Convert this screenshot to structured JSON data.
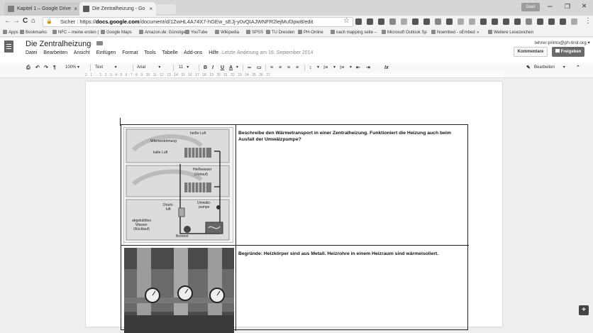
{
  "browser": {
    "tabs": [
      {
        "label": "Kapitel 1 – Google Drive",
        "close": "×"
      },
      {
        "label": "Die Zentralheizung - Go",
        "close": "×"
      }
    ],
    "guest_label": "Gast",
    "window_controls": {
      "minimize": "–",
      "restore": "❐",
      "close": "×"
    },
    "nav": {
      "back": "←",
      "forward": "→",
      "reload": "C",
      "home": "⌂"
    },
    "address": {
      "security": "Sicher",
      "scheme": "https://",
      "host": "docs.google.com",
      "path": "/document/d/1ZwHL4A74X7-hGEw_sEJj-y0vQIAJWNFR2lejMuf3pw8/edit"
    },
    "bookmarks": [
      "Apps",
      "Bookmarks",
      "NFC – meine ersten (",
      "Google Maps",
      "Amazon.de: Günstige",
      "YouTube",
      "Wikipedia",
      "SPSS",
      "TU Dresden",
      "PH-Online",
      "nach mapping seite –",
      "Microsoft Outlook Sp",
      "Noembed - oEmbed",
      "»",
      "Weitere Lesezeichen"
    ]
  },
  "docs": {
    "title": "Die Zentralheizung",
    "menu": [
      "Datei",
      "Bearbeiten",
      "Ansicht",
      "Einfügen",
      "Format",
      "Tools",
      "Tabelle",
      "Add-ons",
      "Hilfe"
    ],
    "last_edit": "Letzte Änderung am 16. September 2014",
    "user_email": "lehrer-primo@ph-tirol.org",
    "comments_button": "Kommentare",
    "share_button": "Freigeben",
    "toolbar": {
      "zoom": "100%",
      "style": "Text",
      "font": "Arial",
      "size": "11",
      "bold": "B",
      "italic": "I",
      "underline": "U",
      "text_color": "A",
      "mode": "Bearbeiten"
    },
    "ruler_marks": "2 · 1 · · · 1 · 2 · 3 · 4 · 5 · 6 · 7 · 8 · 9 · 10 · 11 · 12 · 13 · 14 · 15 · 16 · 17 · 18 · 19 · 20 · 21 · 22 · 23 · 24 · 25 · 26 · 27"
  },
  "document": {
    "diagram_labels": {
      "hot_air": "heiße Luft",
      "heat_flow": "Wärmeströmung",
      "cold_air": "kalte Luft",
      "hot_water": "Heißwasser",
      "flow": "(Vorlauf)",
      "pressure_air": "Druck-\nluft",
      "pump": "Umwälz-\npumpe",
      "cooled_water": "abgekühltes\nWasser\n(Rücklauf)",
      "burner": "Brenner"
    },
    "question1": "Beschreibe den Wärmetransport in einer Zentralheizung. Funktioniert die Heizung auch beim Ausfall der Umwälzpumpe?",
    "question2": "Begründe: Heizkörper sind aus Metall. Heizrohre in einem Heizraum sind wärmeisoliert."
  }
}
